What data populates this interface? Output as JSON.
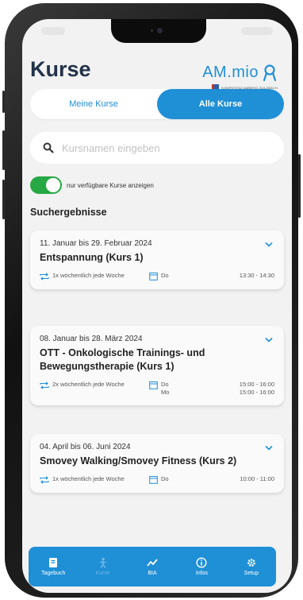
{
  "header": {
    "title": "Kurse",
    "brand_name": "AM.mio",
    "brand_tagline": "KOMPETENZ AMBERG-SULZBACH"
  },
  "segment": {
    "tab_mine": "Meine Kurse",
    "tab_all": "Alle Kurse",
    "active": "Alle Kurse"
  },
  "search": {
    "placeholder": "Kursnamen eingeben",
    "value": ""
  },
  "filter": {
    "label": "nur verfügbare Kurse anzeigen",
    "enabled": true
  },
  "results": {
    "title": "Suchergebnisse",
    "courses": [
      {
        "date": "11. Januar bis 29. Februar 2024",
        "name": "Entspannung (Kurs 1)",
        "frequency": "1x wöchentlich jede Woche",
        "days": "Do",
        "times": "13:30 - 14:30"
      },
      {
        "date": "08. Januar bis 28. März 2024",
        "name": "OTT - Onkologische Trainings- und Bewegungstherapie (Kurs 1)",
        "frequency": "2x wöchentlich jede Woche",
        "days": "Do\nMo",
        "times": "15:00 - 16:00\n15:00 - 16:00"
      },
      {
        "date": "04. April bis 06. Juni 2024",
        "name": "Smovey Walking/Smovey Fitness (Kurs 2)",
        "frequency": "1x wöchentlich jede Woche",
        "days": "Do",
        "times": "10:00 - 11:00"
      }
    ]
  },
  "tabbar": {
    "items": [
      {
        "label": "Tagebuch",
        "icon": "book-icon"
      },
      {
        "label": "Kurse",
        "icon": "person-icon"
      },
      {
        "label": "BIA",
        "icon": "chart-line-icon"
      },
      {
        "label": "Infos",
        "icon": "info-icon"
      },
      {
        "label": "Setup",
        "icon": "gear-icon"
      }
    ]
  },
  "colors": {
    "accent": "#1f8fd6",
    "toggle": "#26a844",
    "title": "#22324a"
  }
}
